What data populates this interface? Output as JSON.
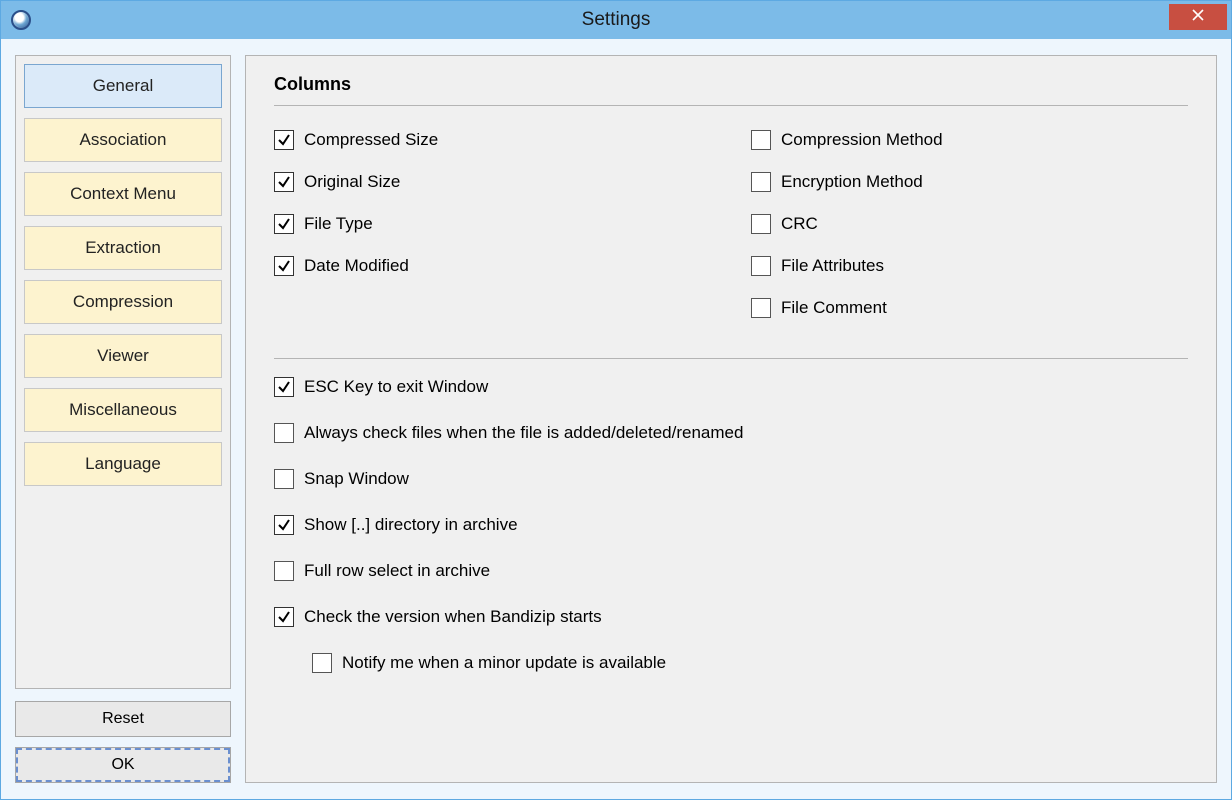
{
  "window": {
    "title": "Settings"
  },
  "sidebar": {
    "tabs": [
      {
        "id": "general",
        "label": "General",
        "active": true
      },
      {
        "id": "association",
        "label": "Association",
        "active": false
      },
      {
        "id": "context-menu",
        "label": "Context Menu",
        "active": false
      },
      {
        "id": "extraction",
        "label": "Extraction",
        "active": false
      },
      {
        "id": "compression",
        "label": "Compression",
        "active": false
      },
      {
        "id": "viewer",
        "label": "Viewer",
        "active": false
      },
      {
        "id": "miscellaneous",
        "label": "Miscellaneous",
        "active": false
      },
      {
        "id": "language",
        "label": "Language",
        "active": false
      }
    ]
  },
  "buttons": {
    "reset": "Reset",
    "ok": "OK"
  },
  "general": {
    "columns_title": "Columns",
    "columns_left": [
      {
        "id": "compressed-size",
        "label": "Compressed Size",
        "checked": true
      },
      {
        "id": "original-size",
        "label": "Original Size",
        "checked": true
      },
      {
        "id": "file-type",
        "label": "File Type",
        "checked": true
      },
      {
        "id": "date-modified",
        "label": "Date Modified",
        "checked": true
      }
    ],
    "columns_right": [
      {
        "id": "compression-method",
        "label": "Compression Method",
        "checked": false
      },
      {
        "id": "encryption-method",
        "label": "Encryption Method",
        "checked": false
      },
      {
        "id": "crc",
        "label": "CRC",
        "checked": false
      },
      {
        "id": "file-attributes",
        "label": "File Attributes",
        "checked": false
      },
      {
        "id": "file-comment",
        "label": "File Comment",
        "checked": false
      }
    ],
    "options": [
      {
        "id": "esc-exit",
        "label": "ESC Key to exit Window",
        "checked": true,
        "indent": 0
      },
      {
        "id": "watch-files",
        "label": "Always check files when the file is added/deleted/renamed",
        "checked": false,
        "indent": 0
      },
      {
        "id": "snap-window",
        "label": "Snap Window",
        "checked": false,
        "indent": 0
      },
      {
        "id": "show-dotdot",
        "label": "Show [..] directory in archive",
        "checked": true,
        "indent": 0
      },
      {
        "id": "full-row-select",
        "label": "Full row select in archive",
        "checked": false,
        "indent": 0
      },
      {
        "id": "check-version",
        "label": "Check the version when Bandizip starts",
        "checked": true,
        "indent": 0
      },
      {
        "id": "notify-minor",
        "label": "Notify me when a minor update is available",
        "checked": false,
        "indent": 1
      }
    ]
  }
}
